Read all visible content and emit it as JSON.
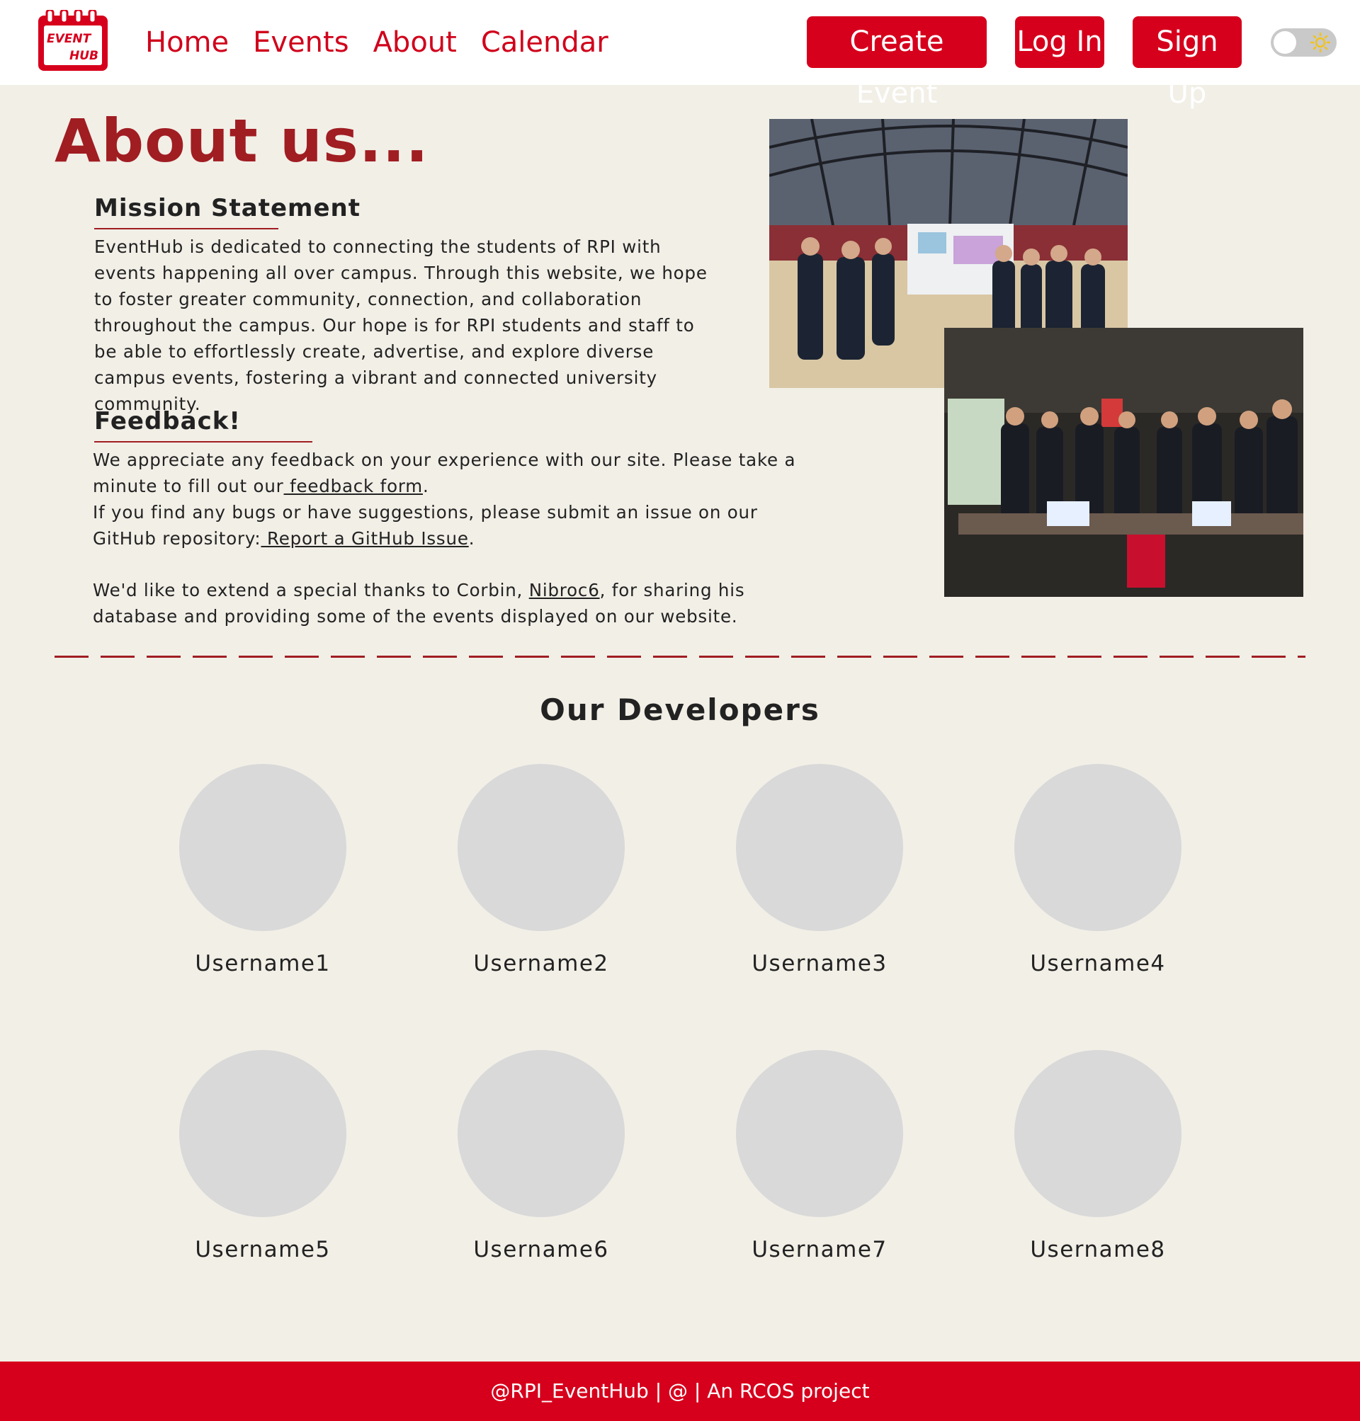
{
  "nav": {
    "logo_text": [
      "EVENT",
      "HUB"
    ],
    "links": [
      "Home",
      "Events",
      "About",
      "Calendar"
    ],
    "create_event": "Create Event",
    "log_in": "Log In",
    "sign_up": "Sign Up",
    "theme_toggle": "light",
    "brand_color": "#d6001c"
  },
  "about": {
    "title": "About us...",
    "mission_heading": "Mission Statement",
    "mission_text": "EventHub is dedicated to connecting the students of RPI with events happening all over campus. Through this website, we hope to foster greater community, connection, and collaboration throughout the campus. Our hope is for RPI students and staff to be able to effortlessly create, advertise, and explore diverse campus events, fostering a vibrant and connected university community.",
    "feedback_heading": "Feedback!",
    "feedback_pre": "We appreciate any feedback on your experience with our site. Please take a minute to fill out our",
    "feedback_link": " feedback form",
    "feedback_post": ".",
    "issue_pre": "If you find any bugs or have suggestions, please submit an issue on our GitHub repository:",
    "issue_link": " Report a GitHub Issue",
    "issue_post": ".",
    "thanks_pre": "We'd like to extend a special thanks to Corbin,",
    "thanks_link": "Nibroc6",
    "thanks_post": ", for sharing his database and providing some of the events displayed on our website.",
    "accent_color": "#a01d22"
  },
  "developers": {
    "title": "Our Developers",
    "people": [
      "Username1",
      "Username2",
      "Username3",
      "Username4",
      "Username5",
      "Username6",
      "Username7",
      "Username8"
    ]
  },
  "footer": {
    "text": "@RPI_EventHub | @ | An RCOS project"
  }
}
